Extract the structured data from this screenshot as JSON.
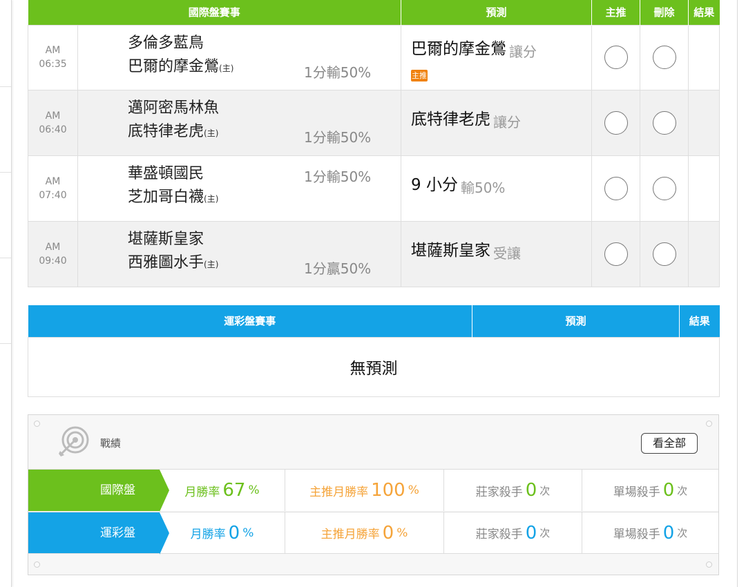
{
  "intl": {
    "headers": [
      "國際盤賽事",
      "預測",
      "主推",
      "刪除",
      "結果"
    ],
    "rows": [
      {
        "ampm": "AM",
        "time": "06:35",
        "team1": "多倫多藍鳥",
        "team2": "巴爾的摩金鶯",
        "host_mark": "(主)",
        "odds": "1分輸50%",
        "pred_team": "巴爾的摩金鶯",
        "pred_type": "讓分",
        "badge": "主推"
      },
      {
        "ampm": "AM",
        "time": "06:40",
        "team1": "邁阿密馬林魚",
        "team2": "底特律老虎",
        "host_mark": "(主)",
        "odds": "1分輸50%",
        "pred_team": "底特律老虎",
        "pred_type": "讓分"
      },
      {
        "ampm": "AM",
        "time": "07:40",
        "team1": "華盛頓國民",
        "team2": "芝加哥白襪",
        "host_mark": "(主)",
        "odds": "1分輸50%",
        "pred_team": "9 小分",
        "pred_type": "輸50%"
      },
      {
        "ampm": "AM",
        "time": "09:40",
        "team1": "堪薩斯皇家",
        "team2": "西雅圖水手",
        "host_mark": "(主)",
        "odds": "1分贏50%",
        "pred_team": "堪薩斯皇家",
        "pred_type": "受讓"
      }
    ]
  },
  "lottery": {
    "headers": [
      "運彩盤賽事",
      "預測",
      "結果"
    ],
    "empty_text": "無預測"
  },
  "record": {
    "title": "戰績",
    "view_all": "看全部",
    "rows": [
      {
        "label": "國際盤",
        "monthly_label": "月勝率",
        "monthly_value": "67",
        "pct": "%",
        "main_label": "主推月勝率",
        "main_value": "100",
        "pct2": "%",
        "dealer_label": "莊家殺手",
        "dealer_value": "0",
        "times": "次",
        "single_label": "單場殺手",
        "single_value": "0",
        "times2": "次"
      },
      {
        "label": "運彩盤",
        "monthly_label": "月勝率",
        "monthly_value": "0",
        "pct": "%",
        "main_label": "主推月勝率",
        "main_value": "0",
        "pct2": "%",
        "dealer_label": "莊家殺手",
        "dealer_value": "0",
        "times": "次",
        "single_label": "單場殺手",
        "single_value": "0",
        "times2": "次"
      }
    ]
  },
  "colors": {
    "green": "#6cc01d",
    "blue": "#14a3e6",
    "orange": "#f5a43a",
    "badge": "#f0820f"
  },
  "icons": {
    "record": "target-icon",
    "select": "radio-circle"
  }
}
